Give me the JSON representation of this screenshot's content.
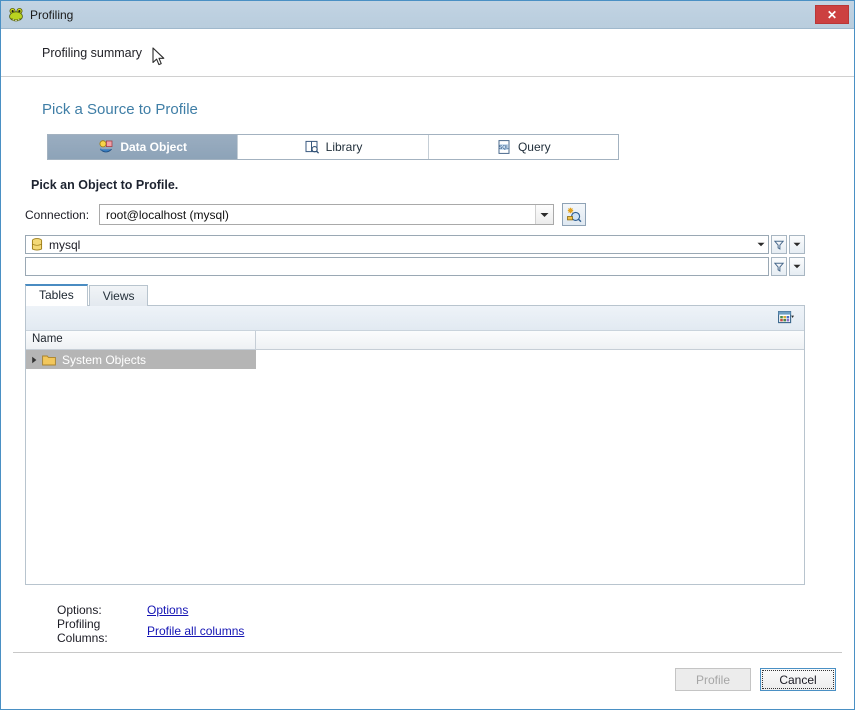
{
  "window": {
    "title": "Profiling",
    "icon": "frog-icon",
    "close_label": "✕"
  },
  "page_header": {
    "title": "Profiling summary"
  },
  "main": {
    "section_title": "Pick a Source to Profile",
    "source_tabs": [
      {
        "label": "Data Object",
        "icon": "data-object-icon",
        "selected": true
      },
      {
        "label": "Library",
        "icon": "library-book-icon",
        "selected": false
      },
      {
        "label": "Query",
        "icon": "sql-query-icon",
        "selected": false
      }
    ],
    "subsection_title": "Pick an Object to Profile.",
    "connection": {
      "label": "Connection:",
      "value": "root@localhost (mysql)",
      "new_connection_icon": "new-connection-icon"
    },
    "schema": {
      "value": "mysql",
      "icon": "database-icon",
      "filter_value": "",
      "filter_placeholder": ""
    },
    "grid_tabs": [
      {
        "label": "Tables",
        "active": true
      },
      {
        "label": "Views",
        "active": false
      }
    ],
    "grid": {
      "columns": [
        "Name",
        ""
      ],
      "rows": [
        {
          "name": "System Objects",
          "icon": "folder-icon",
          "expandable": true,
          "selected": true
        }
      ]
    },
    "options": {
      "options_label": "Options:",
      "options_link": "Options",
      "columns_label": "Profiling Columns:",
      "columns_link": "Profile all columns"
    }
  },
  "footer": {
    "profile_button": "Profile",
    "cancel_button": "Cancel"
  },
  "colors": {
    "titlebar": "#bdd0e0",
    "accent_blue": "#4a90c4",
    "close_red": "#cc4040",
    "heading_blue": "#3f7ea6",
    "link_blue": "#1414b4",
    "selected_tab": "#8da3b8",
    "selected_row": "#b5b5b5"
  }
}
